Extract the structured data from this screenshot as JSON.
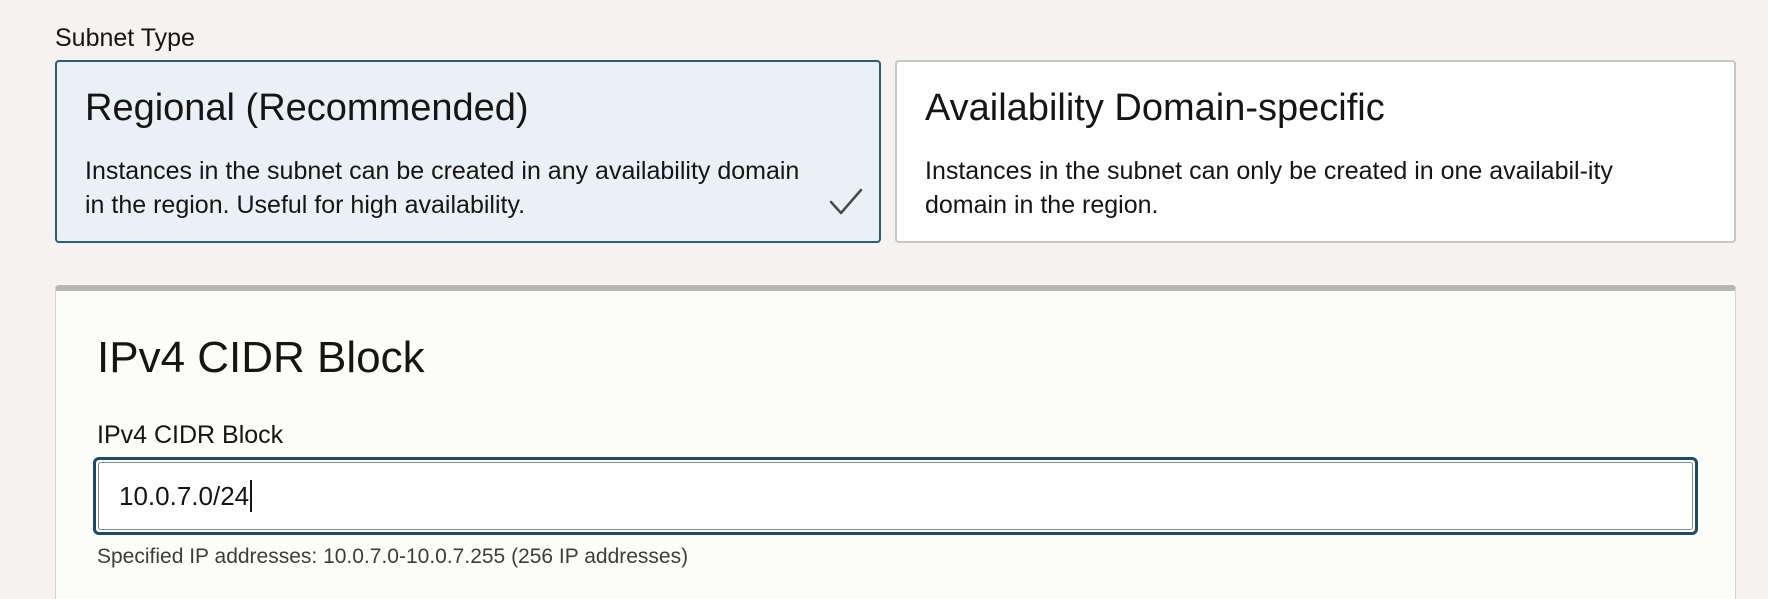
{
  "subnet_type": {
    "label": "Subnet Type",
    "options": [
      {
        "title": "Regional (Recommended)",
        "description": "Instances in the subnet can be created in any availability domain in the region. Useful for high availability.",
        "selected": true
      },
      {
        "title": "Availability Domain-specific",
        "description": "Instances in the subnet can only be created in one availabil-ity domain in the region.",
        "selected": false
      }
    ]
  },
  "cidr_section": {
    "title": "IPv4 CIDR Block",
    "field_label": "IPv4 CIDR Block",
    "value": "10.0.7.0/24",
    "helper": "Specified IP addresses: 10.0.7.0-10.0.7.255 (256 IP addresses)"
  },
  "colors": {
    "selected_bg": "#e9f1f6",
    "selected_border": "#2e5c73",
    "focus_border": "#1f4a63",
    "page_bg": "#f4f3f2"
  },
  "icons": {
    "selected_check": "check-icon"
  }
}
